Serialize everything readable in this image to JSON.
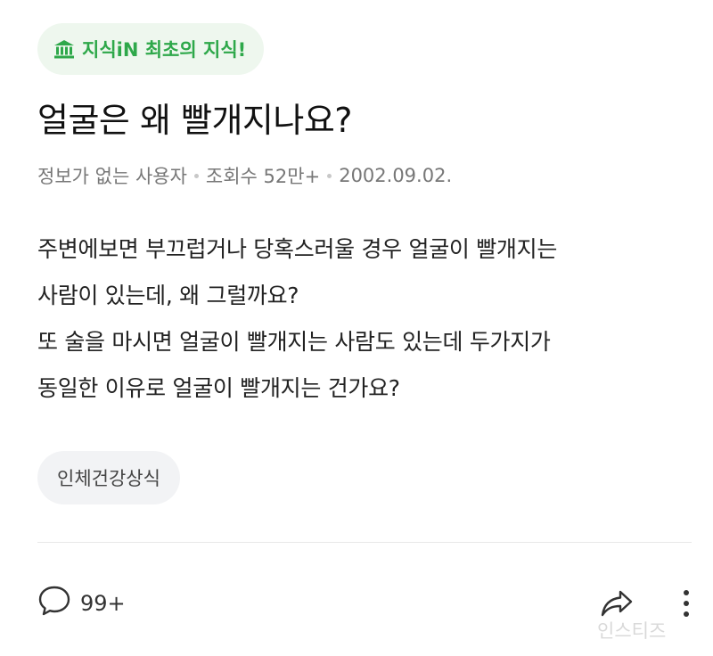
{
  "badge": {
    "icon": "bank-icon",
    "label": "지식iN 최초의 지식!",
    "color": "#2ea84a"
  },
  "question": {
    "title": "얼굴은 왜 빨개지나요?",
    "author": "정보가 없는 사용자",
    "views": "조회수 52만+",
    "date": "2002.09.02.",
    "body_lines": [
      "주변에보면 부끄럽거나 당혹스러울 경우 얼굴이 빨개지는",
      "사람이 있는데, 왜 그럴까요?",
      "또 술을 마시면 얼굴이 빨개지는 사람도 있는데 두가지가",
      "동일한 이유로 얼굴이 빨개지는 건가요?"
    ],
    "tag": "인체건강상식"
  },
  "actions": {
    "comment_icon": "speech-bubble-icon",
    "comment_count": "99+",
    "share_icon": "share-arrow-icon",
    "more_icon": "more-vertical-icon"
  },
  "watermark": "인스티즈"
}
